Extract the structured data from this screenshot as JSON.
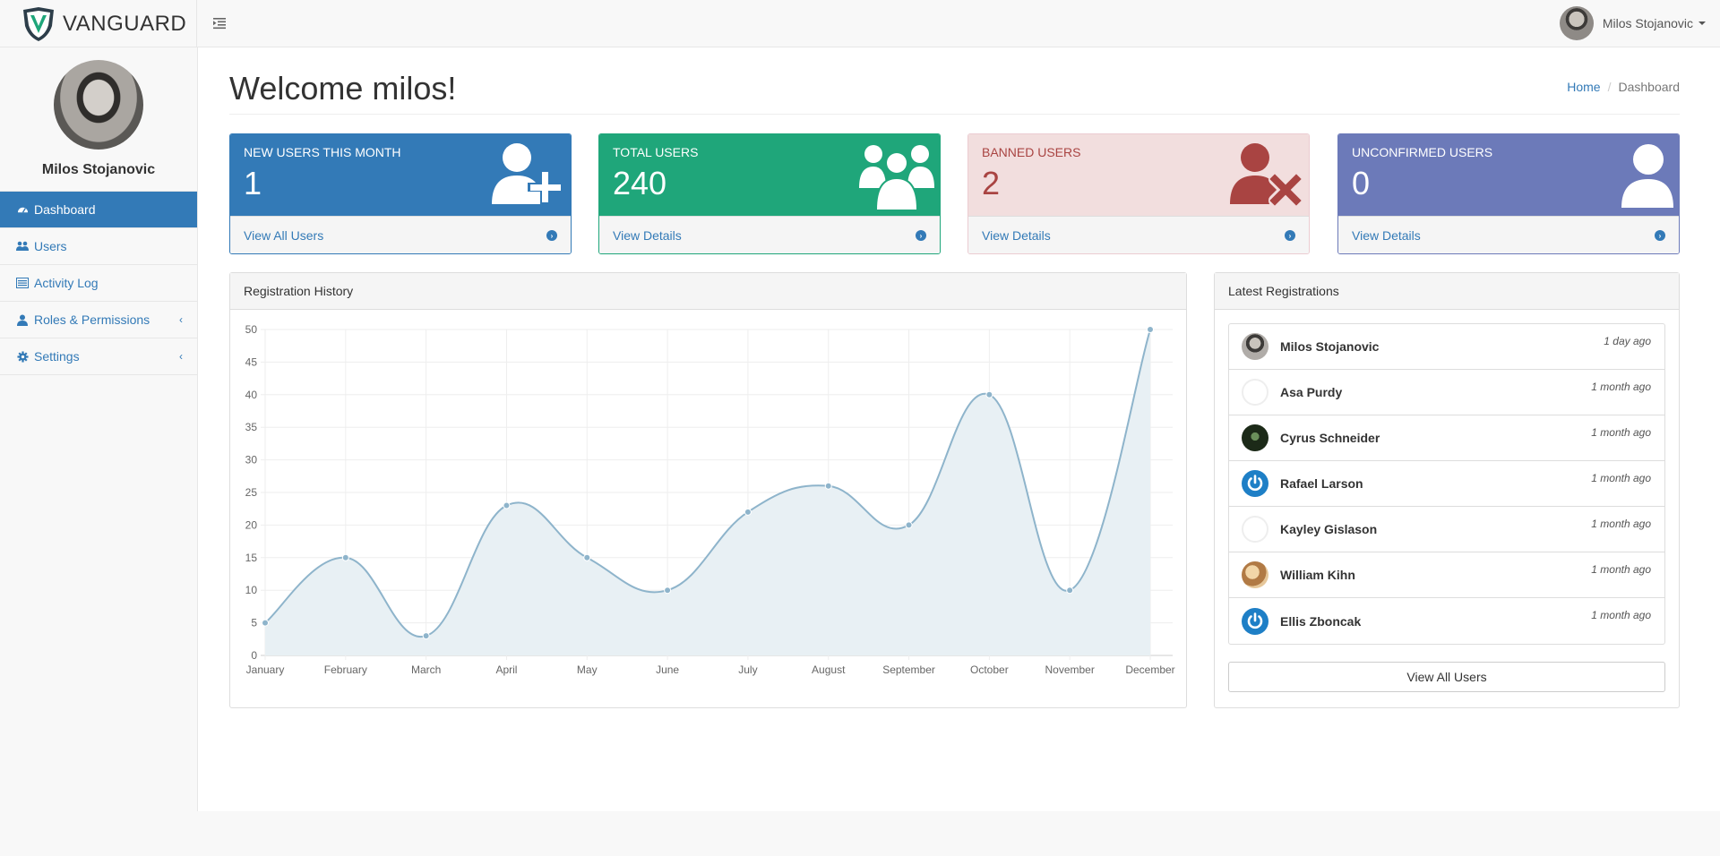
{
  "brand": {
    "part1": "VAN",
    "part2": "GUARD",
    "logo_icon": "shield-logo"
  },
  "navbar": {
    "user_name": "Milos Stojanovic",
    "toggle_icon": "indent-icon"
  },
  "sidebar": {
    "profile_name": "Milos Stojanovic",
    "items": [
      {
        "label": "Dashboard",
        "icon": "dashboard-icon",
        "active": true
      },
      {
        "label": "Users",
        "icon": "users-icon"
      },
      {
        "label": "Activity Log",
        "icon": "list-icon"
      },
      {
        "label": "Roles & Permissions",
        "icon": "user-icon",
        "expandable": true
      },
      {
        "label": "Settings",
        "icon": "gear-icon",
        "expandable": true
      }
    ]
  },
  "page": {
    "title": "Welcome milos!"
  },
  "breadcrumb": {
    "home": "Home",
    "current": "Dashboard"
  },
  "cards": [
    {
      "label": "NEW USERS THIS MONTH",
      "value": "1",
      "link": "View All Users",
      "icon": "user-add-icon",
      "color": "#337ab7"
    },
    {
      "label": "TOTAL USERS",
      "value": "240",
      "link": "View Details",
      "icon": "users-group-icon",
      "color": "#1fa67a"
    },
    {
      "label": "BANNED USERS",
      "value": "2",
      "link": "View Details",
      "icon": "user-banned-icon",
      "color": "#a94442"
    },
    {
      "label": "UNCONFIRMED USERS",
      "value": "0",
      "link": "View Details",
      "icon": "user-icon",
      "color": "#6c7ab9"
    }
  ],
  "registration_history": {
    "heading": "Registration History"
  },
  "chart_data": {
    "type": "area",
    "categories": [
      "January",
      "February",
      "March",
      "April",
      "May",
      "June",
      "July",
      "August",
      "September",
      "October",
      "November",
      "December"
    ],
    "values": [
      5,
      15,
      3,
      23,
      15,
      10,
      22,
      26,
      20,
      40,
      10,
      50
    ],
    "ylim": [
      0,
      50
    ],
    "yticks": [
      0,
      5,
      10,
      15,
      20,
      25,
      30,
      35,
      40,
      45,
      50
    ],
    "grid": true,
    "color": "#8eb4cb",
    "fill": "#e8f0f4"
  },
  "latest_registrations": {
    "heading": "Latest Registrations",
    "items": [
      {
        "name": "Milos Stojanovic",
        "time": "1 day ago",
        "avatar": "photo"
      },
      {
        "name": "Asa Purdy",
        "time": "1 month ago",
        "avatar": "blank"
      },
      {
        "name": "Cyrus Schneider",
        "time": "1 month ago",
        "avatar": "dark"
      },
      {
        "name": "Rafael Larson",
        "time": "1 month ago",
        "avatar": "power"
      },
      {
        "name": "Kayley Gislason",
        "time": "1 month ago",
        "avatar": "blank"
      },
      {
        "name": "William Kihn",
        "time": "1 month ago",
        "avatar": "warm"
      },
      {
        "name": "Ellis Zboncak",
        "time": "1 month ago",
        "avatar": "power"
      }
    ],
    "button": "View All Users"
  }
}
